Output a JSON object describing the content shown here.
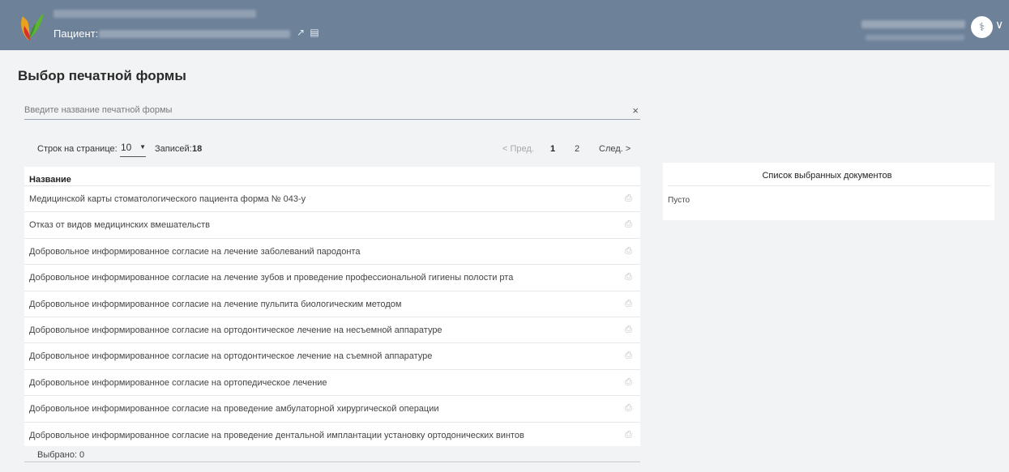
{
  "header": {
    "patient_label": "Пациент:",
    "patient_icons": [
      "open-external-icon",
      "card-icon"
    ],
    "avatar_icon": "stethoscope-icon",
    "chevron_icon": "chevron-down-icon",
    "background_color": "#6d8199"
  },
  "page": {
    "title": "Выбор печатной формы"
  },
  "search": {
    "placeholder": "Введите название печатной формы",
    "value": "",
    "clear_icon": "close-icon"
  },
  "toolbar": {
    "rows_per_page_label": "Строк на странице:",
    "rows_per_page_value": "10",
    "records_label": "Записей:",
    "records_count": "18"
  },
  "pagination": {
    "prev_label": "< Пред.",
    "pages": [
      "1",
      "2"
    ],
    "current_page": "1",
    "next_label": "След. >"
  },
  "table": {
    "header": "Название",
    "rows": [
      {
        "name": "Медицинской карты стоматологического пациента форма № 043-у"
      },
      {
        "name": "Отказ от видов медицинских вмешательств"
      },
      {
        "name": "Добровольное информированное согласие на лечение заболеваний пародонта"
      },
      {
        "name": "Добровольное информированное согласие на лечение зубов и проведение профессиональной гигиены полости рта"
      },
      {
        "name": "Добровольное информированное согласие на лечение пульпита биологическим методом"
      },
      {
        "name": "Добровольное информированное согласие на ортодонтическое лечение на несъемной аппаратуре"
      },
      {
        "name": "Добровольное информированное согласие на ортодонтическое лечение на съемной аппаратуре"
      },
      {
        "name": "Добровольное информированное согласие на ортопедическое лечение"
      },
      {
        "name": "Добровольное информированное согласие на проведение амбулаторной хирургической операции"
      },
      {
        "name": "Добровольное информированное согласие на проведение дентальной имплантации установку ортодонических винтов"
      }
    ],
    "row_icon": "printer-icon"
  },
  "selection": {
    "label": "Выбрано:",
    "count": "0"
  },
  "selected_docs": {
    "title": "Список выбранных документов",
    "empty_text": "Пусто"
  }
}
